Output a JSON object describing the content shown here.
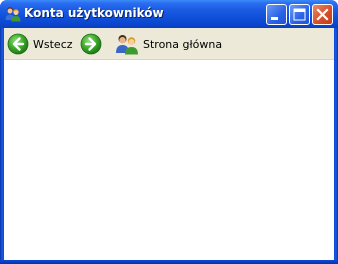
{
  "window": {
    "title": "Konta użytkowników",
    "title_icon": "user-accounts-icon"
  },
  "caption_buttons": {
    "minimize_icon": "minimize-icon",
    "maximize_icon": "maximize-icon",
    "close_icon": "close-icon"
  },
  "toolbar": {
    "back_label": "Wstecz",
    "back_icon": "back-arrow-icon",
    "forward_icon": "forward-arrow-icon",
    "home_label": "Strona główna",
    "home_icon": "users-home-icon"
  },
  "colors": {
    "titlebar": "#0c46cf",
    "toolbar_bg": "#ece9d8",
    "nav_green": "#3aa829",
    "close_red": "#d8502a"
  }
}
